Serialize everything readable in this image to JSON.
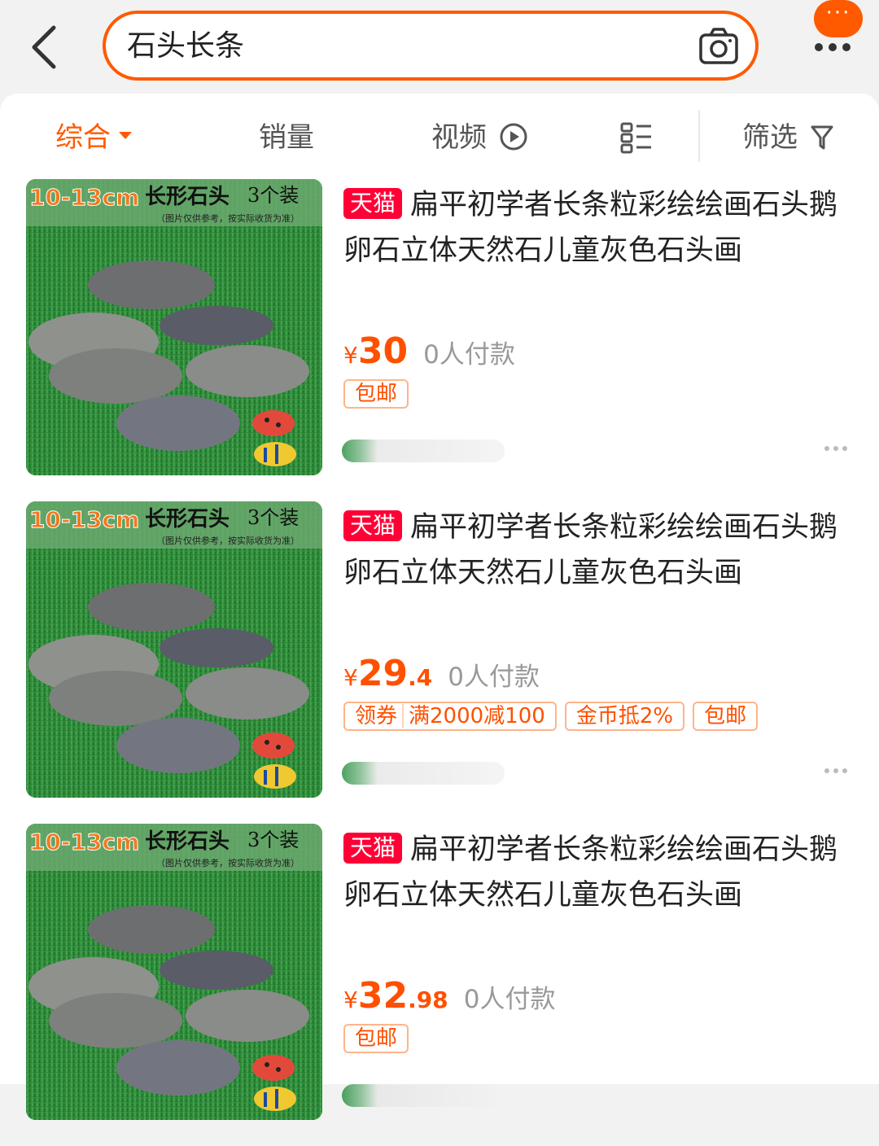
{
  "search": {
    "query": "石头长条",
    "back_icon": "chevron-left-icon",
    "camera_icon": "camera-icon"
  },
  "header": {
    "badge_text": "···",
    "more_icon": "more-dots-icon"
  },
  "sort_bar": {
    "items": [
      {
        "label": "综合",
        "active": true
      },
      {
        "label": "销量",
        "active": false
      },
      {
        "label": "视频",
        "active": false
      },
      {
        "label": "",
        "icon": "list-view-icon",
        "active": false
      },
      {
        "label": "筛选",
        "icon": "filter-icon",
        "active": false
      }
    ]
  },
  "products": [
    {
      "thumb": {
        "size_text": "10-13cm",
        "name_text": "长形石头",
        "count_text": "3个装",
        "note_text": "（图片仅供参考，按实际收货为准）"
      },
      "badge": "天猫",
      "title": "扁平初学者长条粒彩绘绘画石头鹅卵石立体天然石儿童灰色石头画",
      "price_symbol": "¥",
      "price_int": "30",
      "price_dec": "",
      "paid": "0人付款",
      "tags": [
        {
          "segments": [
            "包邮"
          ]
        }
      ]
    },
    {
      "thumb": {
        "size_text": "10-13cm",
        "name_text": "长形石头",
        "count_text": "3个装",
        "note_text": "（图片仅供参考，按实际收货为准）"
      },
      "badge": "天猫",
      "title": "扁平初学者长条粒彩绘绘画石头鹅卵石立体天然石儿童灰色石头画",
      "price_symbol": "¥",
      "price_int": "29",
      "price_dec": ".4",
      "paid": "0人付款",
      "tags": [
        {
          "segments": [
            "领券",
            "满2000减100"
          ]
        },
        {
          "segments": [
            "金币抵2%"
          ]
        },
        {
          "segments": [
            "包邮"
          ]
        }
      ]
    },
    {
      "thumb": {
        "size_text": "10-13cm",
        "name_text": "长形石头",
        "count_text": "3个装",
        "note_text": "（图片仅供参考，按实际收货为准）"
      },
      "badge": "天猫",
      "title": "扁平初学者长条粒彩绘绘画石头鹅卵石立体天然石儿童灰色石头画",
      "price_symbol": "¥",
      "price_int": "32",
      "price_dec": ".98",
      "paid": "0人付款",
      "tags": [
        {
          "segments": [
            "包邮"
          ]
        }
      ]
    }
  ],
  "colors": {
    "accent": "#ff5a00",
    "price": "#ff5000",
    "tmall": "#ff0036"
  }
}
